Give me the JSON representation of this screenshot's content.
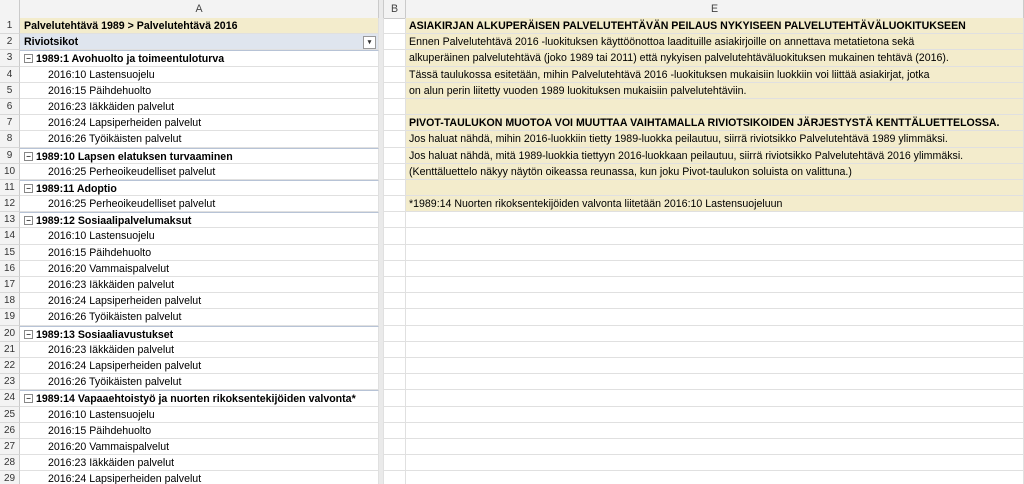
{
  "columns": {
    "a": "A",
    "b": "B",
    "e": "E"
  },
  "row_numbers": [
    "1",
    "2",
    "3",
    "4",
    "5",
    "6",
    "7",
    "8",
    "9",
    "10",
    "11",
    "12",
    "13",
    "14",
    "15",
    "16",
    "17",
    "18",
    "19",
    "20",
    "21",
    "22",
    "23",
    "24",
    "25",
    "26",
    "27",
    "28",
    "29"
  ],
  "pivot": {
    "header": "Palvelutehtävä 1989 > Palvelutehtävä 2016",
    "row_labels": "Riviotsikot",
    "collapse_glyph": "−",
    "dropdown_glyph": "▾",
    "rows": [
      {
        "level": "group",
        "text": "1989:1 Avohuolto ja toimeentuloturva"
      },
      {
        "level": "item",
        "text": "2016:10 Lastensuojelu"
      },
      {
        "level": "item",
        "text": "2016:15 Päihdehuolto"
      },
      {
        "level": "item",
        "text": "2016:23 Iäkkäiden palvelut"
      },
      {
        "level": "item",
        "text": "2016:24 Lapsiperheiden palvelut"
      },
      {
        "level": "item",
        "text": "2016:26 Työikäisten palvelut"
      },
      {
        "level": "group",
        "text": "1989:10 Lapsen elatuksen turvaaminen"
      },
      {
        "level": "item",
        "text": "2016:25 Perheoikeudelliset palvelut"
      },
      {
        "level": "group",
        "text": "1989:11 Adoptio"
      },
      {
        "level": "item",
        "text": "2016:25 Perheoikeudelliset palvelut"
      },
      {
        "level": "group",
        "text": "1989:12 Sosiaalipalvelumaksut"
      },
      {
        "level": "item",
        "text": "2016:10 Lastensuojelu"
      },
      {
        "level": "item",
        "text": "2016:15 Päihdehuolto"
      },
      {
        "level": "item",
        "text": "2016:20 Vammaispalvelut"
      },
      {
        "level": "item",
        "text": "2016:23 Iäkkäiden palvelut"
      },
      {
        "level": "item",
        "text": "2016:24 Lapsiperheiden palvelut"
      },
      {
        "level": "item",
        "text": "2016:26 Työikäisten palvelut"
      },
      {
        "level": "group",
        "text": "1989:13 Sosiaaliavustukset"
      },
      {
        "level": "item",
        "text": "2016:23 Iäkkäiden palvelut"
      },
      {
        "level": "item",
        "text": "2016:24 Lapsiperheiden palvelut"
      },
      {
        "level": "item",
        "text": "2016:26 Työikäisten palvelut"
      },
      {
        "level": "group",
        "text": "1989:14 Vapaaehtoistyö ja nuorten rikoksentekijöiden valvonta*"
      },
      {
        "level": "item",
        "text": "2016:10 Lastensuojelu"
      },
      {
        "level": "item",
        "text": "2016:15 Päihdehuolto"
      },
      {
        "level": "item",
        "text": "2016:20 Vammaispalvelut"
      },
      {
        "level": "item",
        "text": "2016:23 Iäkkäiden palvelut"
      },
      {
        "level": "item",
        "text": "2016:24 Lapsiperheiden palvelut"
      }
    ]
  },
  "notes": [
    {
      "bold": true,
      "text": "ASIAKIRJAN ALKUPERÄISEN PALVELUTEHTÄVÄN PEILAUS NYKYISEEN PALVELUTEHTÄVÄLUOKITUKSEEN"
    },
    {
      "bold": false,
      "text": "Ennen Palvelutehtävä 2016 -luokituksen käyttöönottoa laadituille asiakirjoille on annettava metatietona sekä"
    },
    {
      "bold": false,
      "text": "alkuperäinen palvelutehtävä (joko 1989 tai 2011) että nykyisen palvelutehtäväluokituksen mukainen tehtävä (2016)."
    },
    {
      "bold": false,
      "text": "Tässä taulukossa esitetään, mihin Palvelutehtävä 2016 -luokituksen mukaisiin luokkiin voi liittää asiakirjat, jotka"
    },
    {
      "bold": false,
      "text": "on alun perin liitetty vuoden 1989 luokituksen mukaisiin palvelutehtäviin."
    },
    {
      "bold": false,
      "text": ""
    },
    {
      "bold": true,
      "text": "PIVOT-TAULUKON MUOTOA VOI MUUTTAA VAIHTAMALLA RIVIOTSIKOIDEN JÄRJESTYSTÄ KENTTÄLUETTELOSSA."
    },
    {
      "bold": false,
      "text": "Jos haluat nähdä, mihin 2016-luokkiin tietty 1989-luokka peilautuu, siirrä riviotsikko Palvelutehtävä 1989 ylimmäksi."
    },
    {
      "bold": false,
      "text": "Jos haluat nähdä, mitä 1989-luokkia tiettyyn 2016-luokkaan peilautuu, siirrä riviotsikko Palvelutehtävä 2016 ylimmäksi."
    },
    {
      "bold": false,
      "text": "(Kenttäluettelo näkyy näytön oikeassa reunassa, kun joku Pivot-taulukon soluista on valittuna.)"
    },
    {
      "bold": false,
      "text": ""
    },
    {
      "bold": false,
      "text": "*1989:14 Nuorten rikoksentekijöiden valvonta liitetään 2016:10 Lastensuojeluun"
    }
  ]
}
